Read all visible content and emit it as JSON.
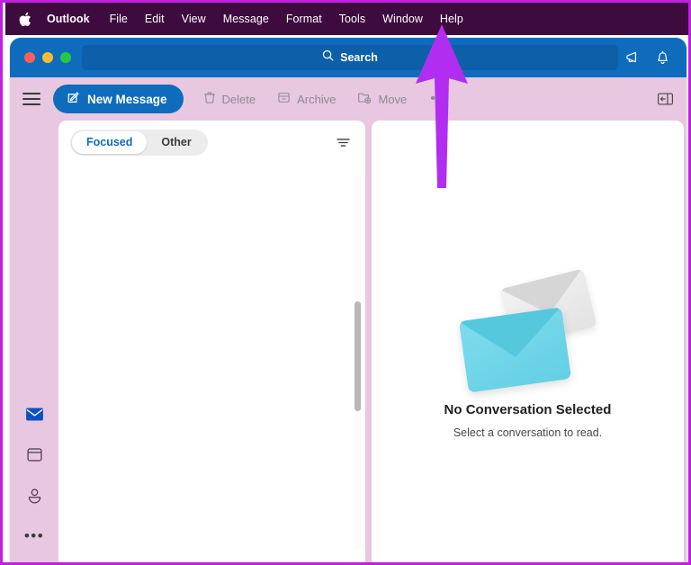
{
  "annotation": {
    "type": "arrow",
    "color": "#b12ef0",
    "points_to": "Help",
    "direction": "up"
  },
  "frame": {
    "border_color": "#c020e0"
  },
  "menubar": {
    "background": "#3d0b3d",
    "apple_icon": "apple-logo-icon",
    "items": [
      {
        "label": "Outlook",
        "bold": true
      },
      {
        "label": "File",
        "bold": false
      },
      {
        "label": "Edit",
        "bold": false
      },
      {
        "label": "View",
        "bold": false
      },
      {
        "label": "Message",
        "bold": false
      },
      {
        "label": "Format",
        "bold": false
      },
      {
        "label": "Tools",
        "bold": false
      },
      {
        "label": "Window",
        "bold": false
      },
      {
        "label": "Help",
        "bold": false
      }
    ]
  },
  "titlebar": {
    "background": "#0f6cbd",
    "traffic_lights": [
      {
        "name": "close",
        "color": "#ff5f57"
      },
      {
        "name": "minimize",
        "color": "#febc2e"
      },
      {
        "name": "zoom",
        "color": "#28c840"
      }
    ],
    "search": {
      "label": "Search",
      "placeholder": "Search",
      "icon": "search-icon",
      "value": ""
    },
    "right_icons": [
      {
        "name": "megaphone-icon",
        "label": "What's New"
      },
      {
        "name": "bell-icon",
        "label": "Notifications"
      }
    ]
  },
  "toolbar": {
    "background": "#e7c8e0",
    "menu_icon": "hamburger-icon",
    "new_message_label": "New Message",
    "new_message_icon": "compose-icon",
    "new_message_color": "#0f6cbd",
    "actions": [
      {
        "label": "Delete",
        "icon": "trash-icon",
        "enabled": false
      },
      {
        "label": "Archive",
        "icon": "archive-icon",
        "enabled": false
      },
      {
        "label": "Move",
        "icon": "move-folder-icon",
        "enabled": false
      }
    ],
    "overflow_label": "•••",
    "pane_toggle_icon": "reading-pane-icon"
  },
  "rail": {
    "items": [
      {
        "name": "mail",
        "icon": "mail-icon",
        "active": true,
        "color": "#0f4fc4"
      },
      {
        "name": "calendar",
        "icon": "calendar-icon",
        "active": false
      },
      {
        "name": "people",
        "icon": "person-icon",
        "active": false
      },
      {
        "name": "more",
        "icon": "more-dots-icon",
        "active": false,
        "label": "•••"
      }
    ]
  },
  "list_pane": {
    "tabs": [
      {
        "label": "Focused",
        "active": true
      },
      {
        "label": "Other",
        "active": false
      }
    ],
    "filter_icon": "filter-icon",
    "messages": [],
    "scrollbar": {
      "visible": true,
      "thumb_color": "#b8b8b8"
    }
  },
  "reading_pane": {
    "illustration": "two-envelopes-illustration",
    "envelope_front_color": "#63cfe4",
    "envelope_back_color": "#e2e2e2",
    "empty_title": "No Conversation Selected",
    "empty_subtitle": "Select a conversation to read."
  }
}
